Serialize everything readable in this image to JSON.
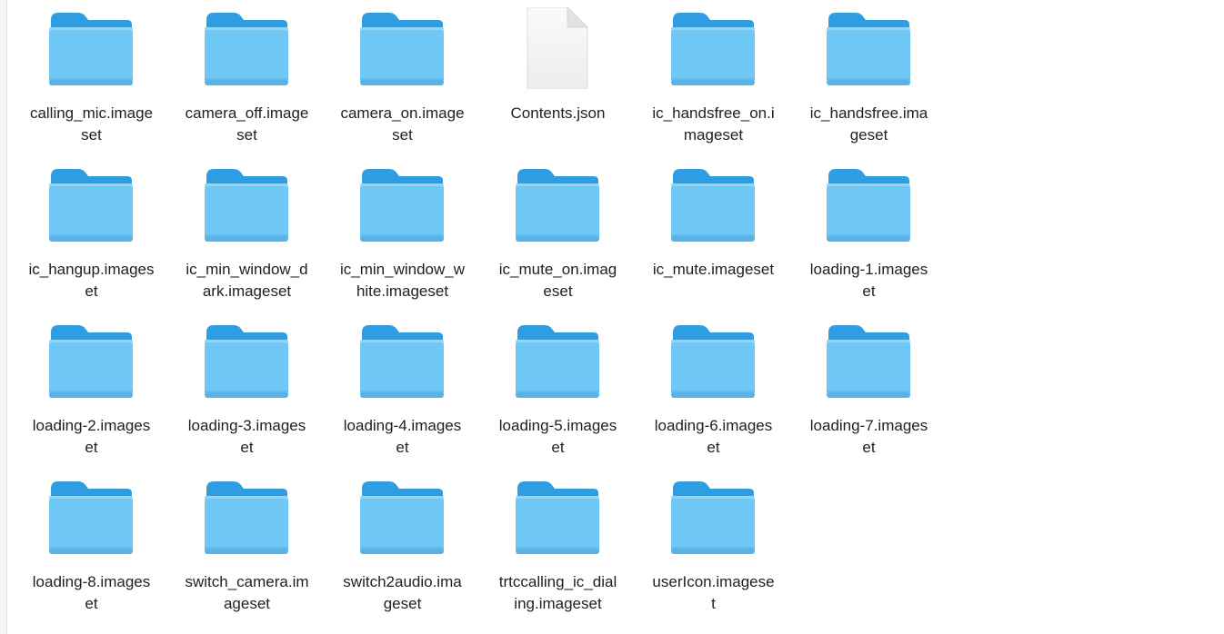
{
  "window": {
    "view_mode": "icon-view",
    "folder_icon": "folder-icon",
    "file_icon": "json-document-icon",
    "colors": {
      "background": "#ffffff",
      "text": "#1f1f1f",
      "folder_body": "#6fc8f5",
      "folder_tab": "#2e9de2",
      "folder_bottom": "#5ab3e6",
      "document": "#f4f4f4"
    }
  },
  "items": [
    {
      "kind": "folder",
      "name": "calling_mic.imageset",
      "line1": "calling_mic.image",
      "line2": "set"
    },
    {
      "kind": "folder",
      "name": "camera_off.imageset",
      "line1": "camera_off.image",
      "line2": "set"
    },
    {
      "kind": "folder",
      "name": "camera_on.imageset",
      "line1": "camera_on.image",
      "line2": "set"
    },
    {
      "kind": "file",
      "name": "Contents.json",
      "line1": "Contents.json",
      "line2": ""
    },
    {
      "kind": "folder",
      "name": "ic_handsfree_on.imageset",
      "line1": "ic_handsfree_on.i",
      "line2": "mageset"
    },
    {
      "kind": "folder",
      "name": "ic_handsfree.imageset",
      "line1": "ic_handsfree.ima",
      "line2": "geset"
    },
    {
      "kind": "folder",
      "name": "ic_hangup.imageset",
      "line1": "ic_hangup.images",
      "line2": "et"
    },
    {
      "kind": "folder",
      "name": "ic_min_window_dark.imageset",
      "line1": "ic_min_window_d",
      "line2": "ark.imageset"
    },
    {
      "kind": "folder",
      "name": "ic_min_window_white.imageset",
      "line1": "ic_min_window_w",
      "line2": "hite.imageset"
    },
    {
      "kind": "folder",
      "name": "ic_mute_on.imageset",
      "line1": "ic_mute_on.imag",
      "line2": "eset"
    },
    {
      "kind": "folder",
      "name": "ic_mute.imageset",
      "line1": "ic_mute.imageset",
      "line2": ""
    },
    {
      "kind": "folder",
      "name": "loading-1.imageset",
      "line1": "loading-1.images",
      "line2": "et"
    },
    {
      "kind": "folder",
      "name": "loading-2.imageset",
      "line1": "loading-2.images",
      "line2": "et"
    },
    {
      "kind": "folder",
      "name": "loading-3.imageset",
      "line1": "loading-3.images",
      "line2": "et"
    },
    {
      "kind": "folder",
      "name": "loading-4.imageset",
      "line1": "loading-4.images",
      "line2": "et"
    },
    {
      "kind": "folder",
      "name": "loading-5.imageset",
      "line1": "loading-5.images",
      "line2": "et"
    },
    {
      "kind": "folder",
      "name": "loading-6.imageset",
      "line1": "loading-6.images",
      "line2": "et"
    },
    {
      "kind": "folder",
      "name": "loading-7.imageset",
      "line1": "loading-7.images",
      "line2": "et"
    },
    {
      "kind": "folder",
      "name": "loading-8.imageset",
      "line1": "loading-8.images",
      "line2": "et"
    },
    {
      "kind": "folder",
      "name": "switch_camera.imageset",
      "line1": "switch_camera.im",
      "line2": "ageset"
    },
    {
      "kind": "folder",
      "name": "switch2audio.imageset",
      "line1": "switch2audio.ima",
      "line2": "geset"
    },
    {
      "kind": "folder",
      "name": "trtccalling_ic_dialing.imageset",
      "line1": "trtccalling_ic_dial",
      "line2": "ing.imageset"
    },
    {
      "kind": "folder",
      "name": "userIcon.imageset",
      "line1": "userIcon.imagese",
      "line2": "t"
    }
  ]
}
